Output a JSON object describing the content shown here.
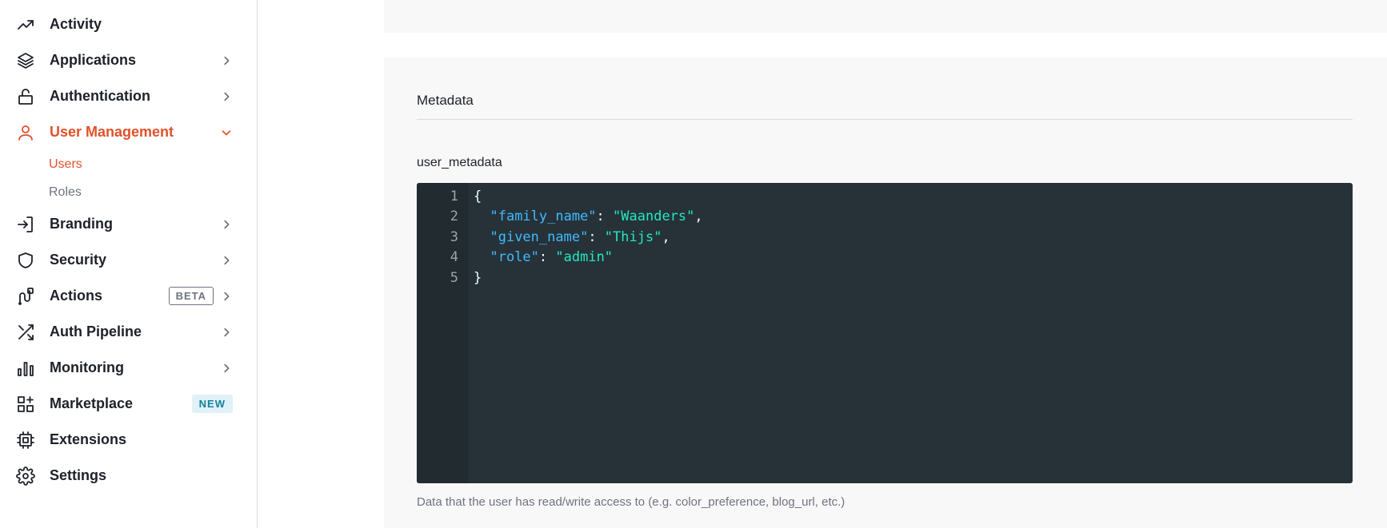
{
  "sidebar": {
    "items": [
      {
        "label": "Activity",
        "icon": "trending-up-icon",
        "chevron": false,
        "badge": ""
      },
      {
        "label": "Applications",
        "icon": "layers-icon",
        "chevron": true,
        "badge": ""
      },
      {
        "label": "Authentication",
        "icon": "lock-icon",
        "chevron": true,
        "badge": ""
      },
      {
        "label": "User Management",
        "icon": "user-icon",
        "chevron": true,
        "badge": "",
        "expanded": true
      },
      {
        "label": "Branding",
        "icon": "sign-in-icon",
        "chevron": true,
        "badge": ""
      },
      {
        "label": "Security",
        "icon": "shield-icon",
        "chevron": true,
        "badge": ""
      },
      {
        "label": "Actions",
        "icon": "actions-icon",
        "chevron": true,
        "badge": "BETA"
      },
      {
        "label": "Auth Pipeline",
        "icon": "shuffle-icon",
        "chevron": true,
        "badge": ""
      },
      {
        "label": "Monitoring",
        "icon": "bar-chart-icon",
        "chevron": true,
        "badge": ""
      },
      {
        "label": "Marketplace",
        "icon": "grid-plus-icon",
        "chevron": false,
        "badge": "NEW"
      },
      {
        "label": "Extensions",
        "icon": "chip-icon",
        "chevron": false,
        "badge": ""
      },
      {
        "label": "Settings",
        "icon": "gear-icon",
        "chevron": false,
        "badge": ""
      }
    ],
    "user_management_sub": [
      {
        "label": "Users",
        "active": true
      },
      {
        "label": "Roles",
        "active": false
      }
    ]
  },
  "metadata": {
    "section_title": "Metadata",
    "field_label": "user_metadata",
    "helper_text": "Data that the user has read/write access to (e.g. color_preference, blog_url, etc.)",
    "editor": {
      "line_numbers": [
        "1",
        "2",
        "3",
        "4",
        "5"
      ],
      "lines": {
        "l1_open": "{",
        "l2_key": "\"family_name\"",
        "l2_sep": ": ",
        "l2_val": "\"Waanders\"",
        "l2_end": ",",
        "l3_key": "\"given_name\"",
        "l3_sep": ": ",
        "l3_val": "\"Thijs\"",
        "l3_end": ",",
        "l4_key": "\"role\"",
        "l4_sep": ": ",
        "l4_val": "\"admin\"",
        "l5_close": "}"
      }
    }
  },
  "colors": {
    "accent": "#e0512a",
    "editor_bg": "#263238",
    "json_key": "#41b9ff",
    "json_string": "#22e8c2",
    "badge_new_bg": "#dff2f8",
    "badge_new_text": "#15809a"
  }
}
